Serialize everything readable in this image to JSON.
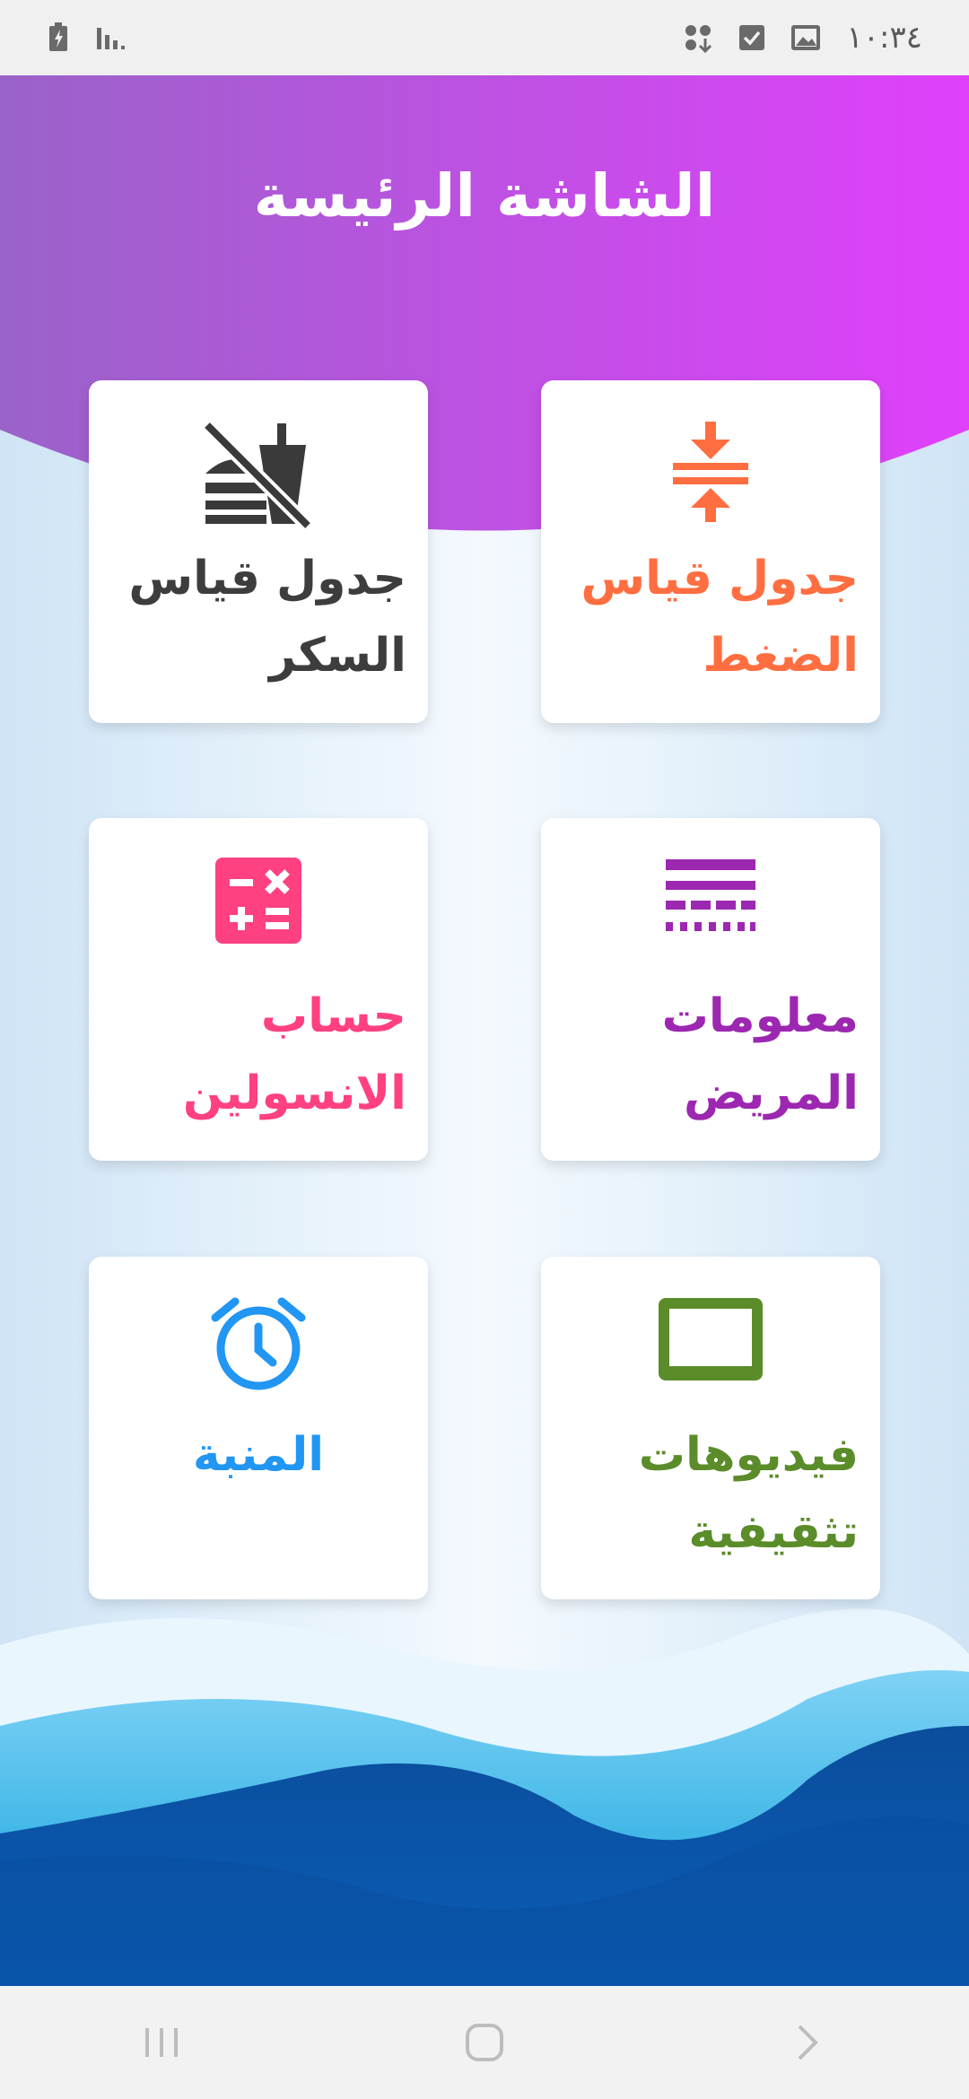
{
  "status_bar": {
    "time": "١٠:٣٤",
    "icons": [
      "battery-charging-icon",
      "signal-icon",
      "apps-icon",
      "checkbox-icon",
      "image-icon"
    ]
  },
  "header": {
    "title": "الشاشة الرئيسة"
  },
  "cards": {
    "pressure": {
      "label": "جدول قياس الضغط",
      "icon": "compress-icon",
      "color": "#ff6e40"
    },
    "sugar": {
      "label": "جدول قياس السكر",
      "icon": "no-food-icon",
      "color": "#3d3d3d"
    },
    "patient": {
      "label": "معلومات المريض",
      "icon": "notes-icon",
      "color": "#9c27b0"
    },
    "insulin": {
      "label": "حساب الانسولين",
      "icon": "calculator-icon",
      "color": "#ff4081"
    },
    "videos": {
      "label": "فيديوهات تثقيفية",
      "icon": "video-screen-icon",
      "color": "#5b8c2a"
    },
    "alarm": {
      "label": "المنبة",
      "icon": "alarm-clock-icon",
      "color": "#2196f3"
    }
  },
  "colors": {
    "header_gradient_start": "#9a63c9",
    "header_gradient_end": "#e040fb",
    "wave_dark": "#0d4fa1",
    "wave_light": "#12a0dc"
  },
  "nav_bar": {
    "buttons": [
      "recent-apps-icon",
      "home-icon",
      "back-icon"
    ]
  }
}
